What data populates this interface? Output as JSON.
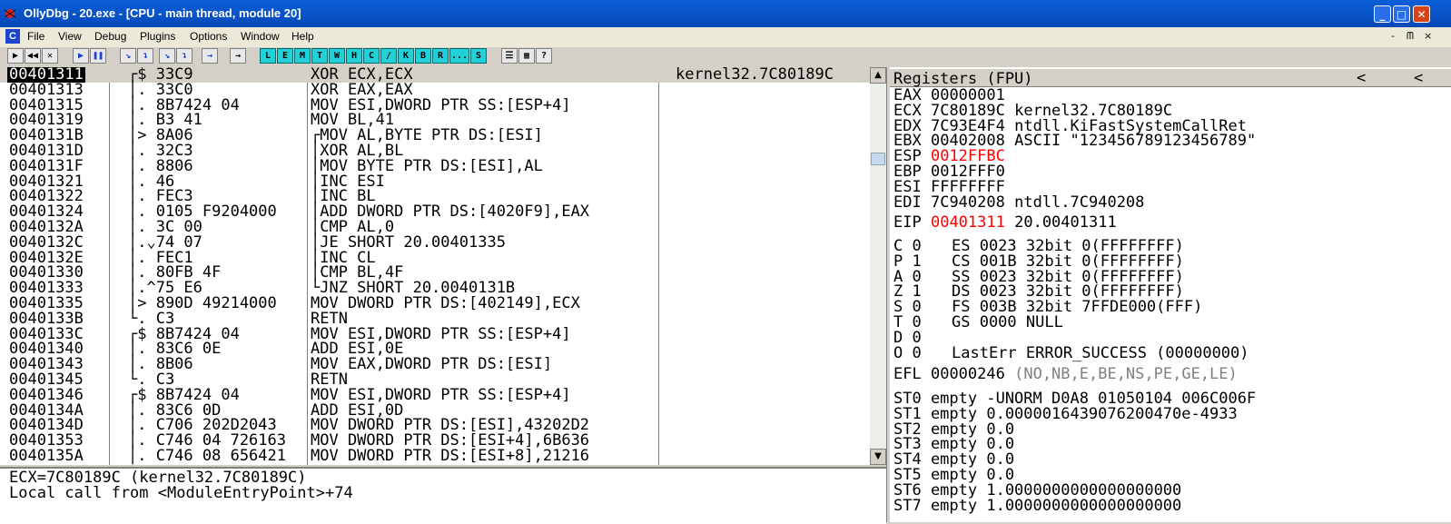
{
  "titlebar": {
    "title": "OllyDbg - 20.exe - [CPU - main thread, module 20]",
    "buttons": [
      "_",
      "□",
      "✕"
    ]
  },
  "menubar": {
    "app_icon": "C",
    "items": [
      "File",
      "View",
      "Debug",
      "Plugins",
      "Options",
      "Window",
      "Help"
    ],
    "mdi_buttons": [
      "-",
      "ᗰ",
      "×"
    ]
  },
  "toolbar": {
    "buttons": [
      "▶",
      "◀◀",
      "✕",
      "▶",
      "❚❚",
      "↘",
      "↴",
      "↘",
      "↴",
      "→",
      "→",
      "L",
      "E",
      "M",
      "T",
      "W",
      "H",
      "C",
      "/",
      "K",
      "B",
      "R",
      "...",
      "S",
      "☰",
      "▦",
      "?"
    ]
  },
  "disasm": {
    "rows": [
      {
        "addr": "00401311",
        "hex": "┌$ 33C9",
        "asm": "XOR ECX,ECX",
        "cmt": "kernel32.7C80189C",
        "cur": true
      },
      {
        "addr": "00401313",
        "hex": "│. 33C0",
        "asm": "XOR EAX,EAX",
        "cmt": ""
      },
      {
        "addr": "00401315",
        "hex": "│. 8B7424 04",
        "asm": "MOV ESI,DWORD PTR SS:[ESP+4]",
        "cmt": ""
      },
      {
        "addr": "00401319",
        "hex": "│. B3 41",
        "asm": "MOV BL,41",
        "cmt": ""
      },
      {
        "addr": "0040131B",
        "hex": "│> 8A06",
        "asm": "┌MOV AL,BYTE PTR DS:[ESI]",
        "cmt": ""
      },
      {
        "addr": "0040131D",
        "hex": "│. 32C3",
        "asm": "│XOR AL,BL",
        "cmt": ""
      },
      {
        "addr": "0040131F",
        "hex": "│. 8806",
        "asm": "│MOV BYTE PTR DS:[ESI],AL",
        "cmt": ""
      },
      {
        "addr": "00401321",
        "hex": "│. 46",
        "asm": "│INC ESI",
        "cmt": ""
      },
      {
        "addr": "00401322",
        "hex": "│. FEC3",
        "asm": "│INC BL",
        "cmt": ""
      },
      {
        "addr": "00401324",
        "hex": "│. 0105 F9204000",
        "asm": "│ADD DWORD PTR DS:[4020F9],EAX",
        "cmt": ""
      },
      {
        "addr": "0040132A",
        "hex": "│. 3C 00",
        "asm": "│CMP AL,0",
        "cmt": ""
      },
      {
        "addr": "0040132C",
        "hex": "│.⌄74 07",
        "asm": "│JE SHORT 20.00401335",
        "cmt": ""
      },
      {
        "addr": "0040132E",
        "hex": "│. FEC1",
        "asm": "│INC CL",
        "cmt": ""
      },
      {
        "addr": "00401330",
        "hex": "│. 80FB 4F",
        "asm": "│CMP BL,4F",
        "cmt": ""
      },
      {
        "addr": "00401333",
        "hex": "│.^75 E6",
        "asm": "└JNZ SHORT 20.0040131B",
        "cmt": ""
      },
      {
        "addr": "00401335",
        "hex": "│> 890D 49214000",
        "asm": "MOV DWORD PTR DS:[402149],ECX",
        "cmt": ""
      },
      {
        "addr": "0040133B",
        "hex": "└. C3",
        "asm": "RETN",
        "cmt": ""
      },
      {
        "addr": "0040133C",
        "hex": "┌$ 8B7424 04",
        "asm": "MOV ESI,DWORD PTR SS:[ESP+4]",
        "cmt": ""
      },
      {
        "addr": "00401340",
        "hex": "│. 83C6 0E",
        "asm": "ADD ESI,0E",
        "cmt": ""
      },
      {
        "addr": "00401343",
        "hex": "│. 8B06",
        "asm": "MOV EAX,DWORD PTR DS:[ESI]",
        "cmt": ""
      },
      {
        "addr": "00401345",
        "hex": "└. C3",
        "asm": "RETN",
        "cmt": ""
      },
      {
        "addr": "00401346",
        "hex": "┌$ 8B7424 04",
        "asm": "MOV ESI,DWORD PTR SS:[ESP+4]",
        "cmt": ""
      },
      {
        "addr": "0040134A",
        "hex": "│. 83C6 0D",
        "asm": "ADD ESI,0D",
        "cmt": ""
      },
      {
        "addr": "0040134D",
        "hex": "│. C706 202D2043",
        "asm": "MOV DWORD PTR DS:[ESI],43202D2",
        "cmt": ""
      },
      {
        "addr": "00401353",
        "hex": "│. C746 04 726163",
        "asm": "MOV DWORD PTR DS:[ESI+4],6B636",
        "cmt": ""
      },
      {
        "addr": "0040135A",
        "hex": "│. C746 08 656421",
        "asm": "MOV DWORD PTR DS:[ESI+8],21216",
        "cmt": ""
      }
    ]
  },
  "info": {
    "line1": "ECX=7C80189C (kernel32.7C80189C)",
    "line2": "Local call from <ModuleEntryPoint>+74"
  },
  "registers": {
    "header": "Registers (FPU)",
    "gp": [
      {
        "name": "EAX",
        "value": "00000001",
        "desc": "",
        "red": false
      },
      {
        "name": "ECX",
        "value": "7C80189C",
        "desc": "kernel32.7C80189C",
        "red": false
      },
      {
        "name": "EDX",
        "value": "7C93E4F4",
        "desc": "ntdll.KiFastSystemCallRet",
        "red": false
      },
      {
        "name": "EBX",
        "value": "00402008",
        "desc": "ASCII \"123456789123456789\"",
        "red": false
      },
      {
        "name": "ESP",
        "value": "0012FFBC",
        "desc": "",
        "red": true
      },
      {
        "name": "EBP",
        "value": "0012FFF0",
        "desc": "",
        "red": false
      },
      {
        "name": "ESI",
        "value": "FFFFFFFF",
        "desc": "",
        "red": false
      },
      {
        "name": "EDI",
        "value": "7C940208",
        "desc": "ntdll.7C940208",
        "red": false
      }
    ],
    "eip": {
      "name": "EIP",
      "value": "00401311",
      "desc": "20.00401311"
    },
    "flags": [
      {
        "flag": "C 0",
        "seg": "ES 0023 32bit 0(FFFFFFFF)"
      },
      {
        "flag": "P 1",
        "seg": "CS 001B 32bit 0(FFFFFFFF)"
      },
      {
        "flag": "A 0",
        "seg": "SS 0023 32bit 0(FFFFFFFF)"
      },
      {
        "flag": "Z 1",
        "seg": "DS 0023 32bit 0(FFFFFFFF)"
      },
      {
        "flag": "S 0",
        "seg": "FS 003B 32bit 7FFDE000(FFF)"
      },
      {
        "flag": "T 0",
        "seg": "GS 0000 NULL"
      },
      {
        "flag": "D 0",
        "seg": ""
      },
      {
        "flag": "O 0",
        "seg": "LastErr ERROR_SUCCESS (00000000)"
      }
    ],
    "efl": {
      "name": "EFL",
      "value": "00000246",
      "desc": "(NO,NB,E,BE,NS,PE,GE,LE)"
    },
    "fpu": [
      "ST0 empty -UNORM D0A8 01050104 006C006F",
      "ST1 empty 0.0000016439076200470e-4933",
      "ST2 empty 0.0",
      "ST3 empty 0.0",
      "ST4 empty 0.0",
      "ST5 empty 0.0",
      "ST6 empty 1.0000000000000000000",
      "ST7 empty 1.0000000000000000000"
    ]
  }
}
